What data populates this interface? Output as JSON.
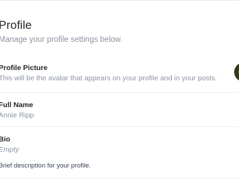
{
  "header": {
    "title": "Profile",
    "subtitle": "Manage your profile settings below."
  },
  "profile_picture": {
    "label": "Profile Picture",
    "description": "This will be the avatar that appears on your profile and in your posts.",
    "avatar_icon": "avatar"
  },
  "full_name": {
    "label": "Full Name",
    "value": "Annie Ripp"
  },
  "bio": {
    "label": "Bio",
    "value": "Empty",
    "help": "Brief description for your profile."
  }
}
